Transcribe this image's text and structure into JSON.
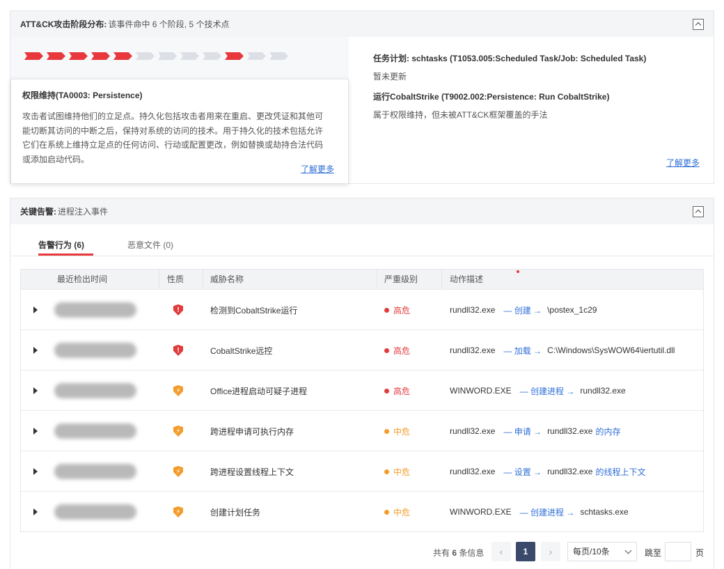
{
  "attack": {
    "title": "ATT&CK攻击阶段分布:",
    "subtitle": "该事件命中 6 个阶段, 5 个技术点",
    "phases": [
      true,
      true,
      true,
      true,
      true,
      false,
      false,
      false,
      false,
      true,
      false,
      false
    ],
    "popover": {
      "title": "权限维持(TA0003: Persistence)",
      "desc": "攻击者试图维持他们的立足点。持久化包括攻击者用来在重启、更改凭证和其他可能切断其访问的中断之后，保持对系统的访问的技术。用于持久化的技术包括允许它们在系统上维持立足点的任何访问、行动或配置更改，例如替换或劫持合法代码或添加启动代码。",
      "more": "了解更多"
    },
    "techniques": [
      {
        "title": "任务计划: schtasks (T1053.005:Scheduled Task/Job: Scheduled Task)",
        "desc": "暂未更新"
      },
      {
        "title": "运行CobaltStrike (T9002.002:Persistence: Run CobaltStrike)",
        "desc": "属于权限维持，但未被ATT&CK框架覆盖的手法"
      }
    ],
    "more": "了解更多"
  },
  "alerts": {
    "title": "关键告警:",
    "subtitle": "进程注入事件",
    "tabs": [
      {
        "label": "告警行为 (6)"
      },
      {
        "label": "恶意文件 (0)"
      }
    ],
    "columns": [
      "最近检出时间",
      "性质",
      "威胁名称",
      "严重级别",
      "动作描述"
    ],
    "rows": [
      {
        "icon": "red",
        "name": "检测到CobaltStrike运行",
        "severity": "高危",
        "sevColor": "#e13b3b",
        "proc": "rundll32.exe",
        "action": "— 创建 →",
        "target": "\\postex_1c29",
        "suffix": ""
      },
      {
        "icon": "red",
        "name": "CobaltStrike远控",
        "severity": "高危",
        "sevColor": "#e13b3b",
        "proc": "rundll32.exe",
        "action": "— 加载 →",
        "target": "C:\\Windows\\SysWOW64\\iertutil.dll",
        "suffix": ""
      },
      {
        "icon": "orange",
        "name": "Office进程启动可疑子进程",
        "severity": "高危",
        "sevColor": "#e13b3b",
        "proc": "WINWORD.EXE",
        "action": "— 创建进程 →",
        "target": "rundll32.exe",
        "suffix": ""
      },
      {
        "icon": "orange",
        "name": "跨进程申请可执行内存",
        "severity": "中危",
        "sevColor": "#f39c2b",
        "proc": "rundll32.exe",
        "action": "— 申请 →",
        "target": "rundll32.exe",
        "suffix": "的内存"
      },
      {
        "icon": "orange",
        "name": "跨进程设置线程上下文",
        "severity": "中危",
        "sevColor": "#f39c2b",
        "proc": "rundll32.exe",
        "action": "— 设置 →",
        "target": "rundll32.exe",
        "suffix": "的线程上下文"
      },
      {
        "icon": "orange",
        "name": "创建计划任务",
        "severity": "中危",
        "sevColor": "#f39c2b",
        "proc": "WINWORD.EXE",
        "action": "— 创建进程 →",
        "target": "schtasks.exe",
        "suffix": ""
      }
    ]
  },
  "pager": {
    "total_prefix": "共有",
    "total_count": "6",
    "total_suffix": "条信息",
    "prev": "‹",
    "current": "1",
    "next": "›",
    "page_size": "每页/10条",
    "jump_label": "跳至",
    "jump_value": "",
    "page_label": "页"
  },
  "colors": {
    "accent": "#e8383d",
    "link": "#2f6fd6",
    "high": "#e13b3b",
    "medium": "#f39c2b"
  }
}
